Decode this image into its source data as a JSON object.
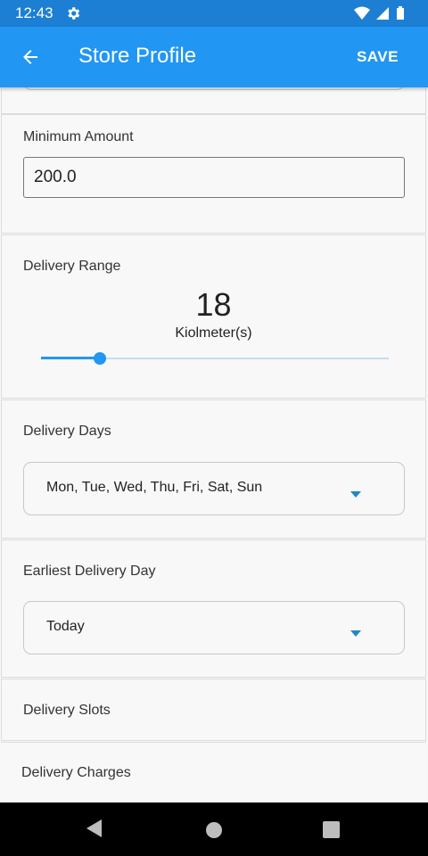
{
  "status_bar": {
    "time": "12:43",
    "icons": [
      "gear-icon",
      "wifi-icon",
      "signal-icon",
      "battery-icon"
    ]
  },
  "app_bar": {
    "title": "Store Profile",
    "save_label": "SAVE",
    "back_icon": "arrow-left-icon",
    "color": "#2196f3"
  },
  "minimum_amount": {
    "label": "Minimum Amount",
    "value": "200.0"
  },
  "delivery_range": {
    "label": "Delivery Range",
    "value": "18",
    "unit": "Kiolmeter(s)",
    "slider_fraction": 0.17
  },
  "delivery_days": {
    "label": "Delivery Days",
    "selected": "Mon, Tue, Wed, Thu, Fri, Sat, Sun"
  },
  "earliest_delivery_day": {
    "label": "Earliest Delivery Day",
    "selected": "Today"
  },
  "delivery_slots": {
    "label": "Delivery Slots"
  },
  "delivery_charges": {
    "label": "Delivery Charges"
  },
  "nav_bar": {
    "icons": [
      "back-nav-icon",
      "home-nav-icon",
      "recents-nav-icon"
    ]
  }
}
